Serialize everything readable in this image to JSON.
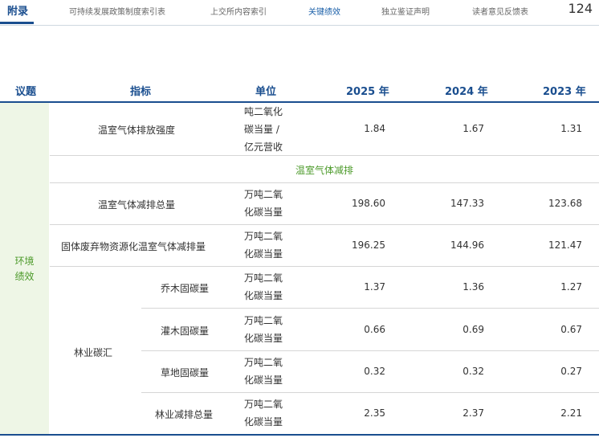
{
  "nav": {
    "appendix": "附录",
    "items": [
      "可持续发展政策制度索引表",
      "上交所内容索引",
      "关键绩效",
      "独立鉴证声明",
      "读者意见反馈表"
    ],
    "page_number": "124"
  },
  "table": {
    "headers": {
      "topic": "议题",
      "indicator": "指标",
      "unit": "单位",
      "y2025": "2025 年",
      "y2024": "2024 年",
      "y2023": "2023 年"
    },
    "category": "环境\n绩效",
    "subheader": "温室气体减排",
    "forestry_group": "林业碳汇",
    "rows": [
      {
        "indicator": "温室气体排放强度",
        "unit": "吨二氧化\n碳当量 /\n亿元营收",
        "y2025": "1.84",
        "y2024": "1.67",
        "y2023": "1.31"
      },
      {
        "indicator": "温室气体减排总量",
        "unit": "万吨二氧\n化碳当量",
        "y2025": "198.60",
        "y2024": "147.33",
        "y2023": "123.68"
      },
      {
        "indicator": "固体废弃物资源化温室气体减排量",
        "unit": "万吨二氧\n化碳当量",
        "y2025": "196.25",
        "y2024": "144.96",
        "y2023": "121.47"
      },
      {
        "indicator": "乔木固碳量",
        "unit": "万吨二氧\n化碳当量",
        "y2025": "1.37",
        "y2024": "1.36",
        "y2023": "1.27"
      },
      {
        "indicator": "灌木固碳量",
        "unit": "万吨二氧\n化碳当量",
        "y2025": "0.66",
        "y2024": "0.69",
        "y2023": "0.67"
      },
      {
        "indicator": "草地固碳量",
        "unit": "万吨二氧\n化碳当量",
        "y2025": "0.32",
        "y2024": "0.32",
        "y2023": "0.27"
      },
      {
        "indicator": "林业减排总量",
        "unit": "万吨二氧\n化碳当量",
        "y2025": "2.35",
        "y2024": "2.37",
        "y2023": "2.21"
      }
    ]
  }
}
